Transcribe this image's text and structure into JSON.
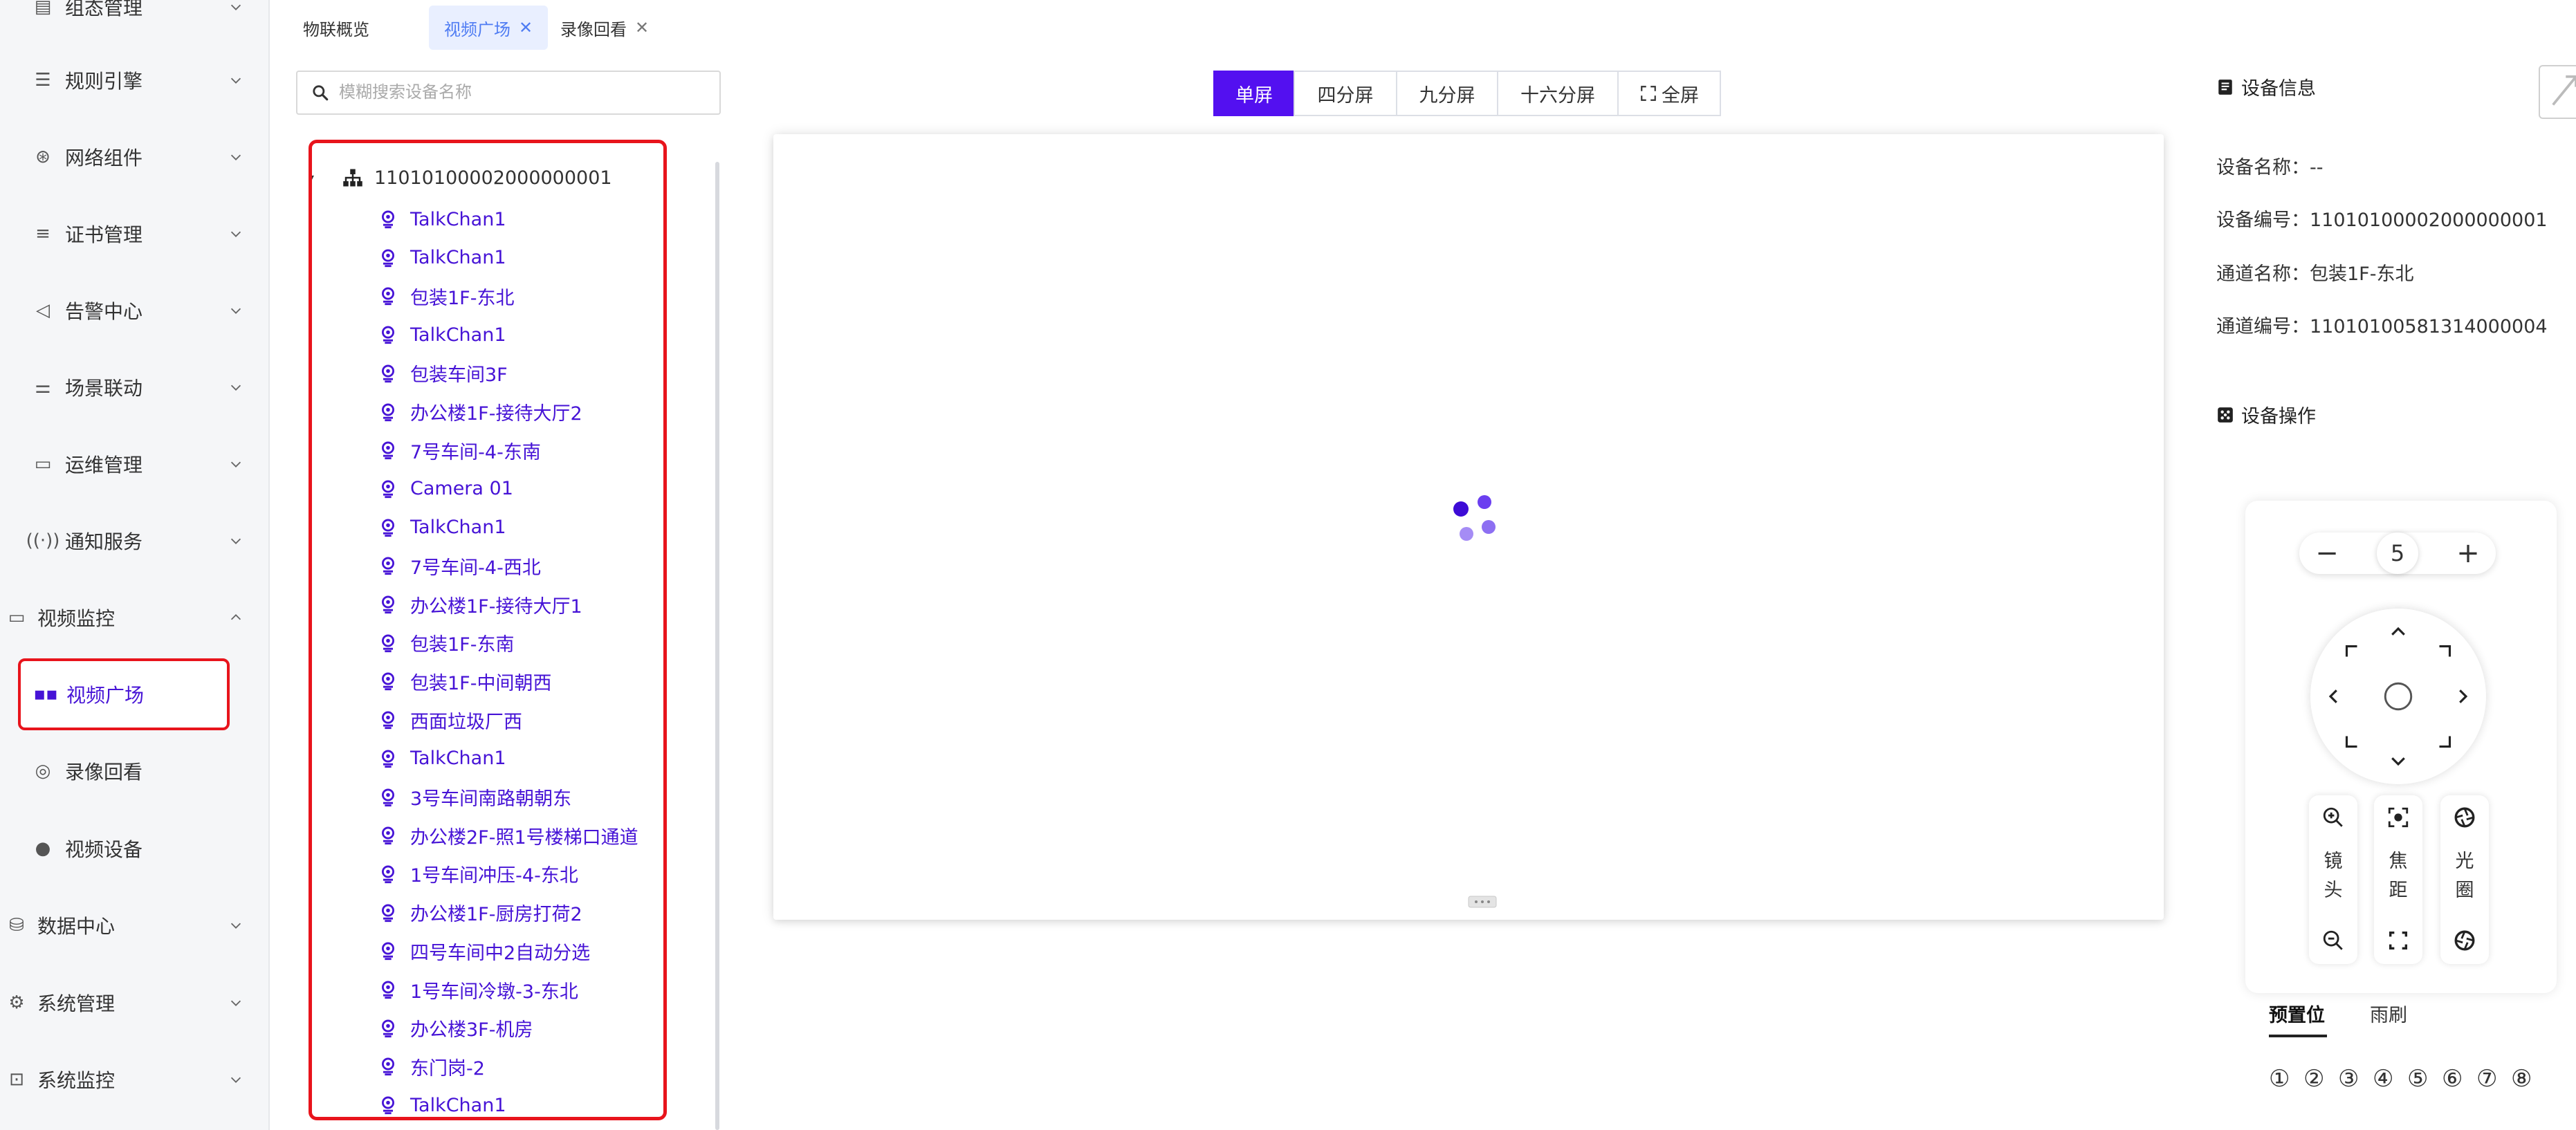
{
  "sidebar": {
    "items": [
      {
        "label": "组态管理",
        "icon": "monitor-icon",
        "expanded": false
      },
      {
        "label": "规则引擎",
        "icon": "list-icon",
        "expanded": false
      },
      {
        "label": "网络组件",
        "icon": "network-icon",
        "expanded": false
      },
      {
        "label": "证书管理",
        "icon": "menu-lines-icon",
        "expanded": false
      },
      {
        "label": "告警中心",
        "icon": "speaker-icon",
        "expanded": false
      },
      {
        "label": "场景联动",
        "icon": "sliders-icon",
        "expanded": false
      },
      {
        "label": "运维管理",
        "icon": "briefcase-icon",
        "expanded": false
      },
      {
        "label": "通知服务",
        "icon": "broadcast-icon",
        "expanded": false
      }
    ],
    "video_group": {
      "label": "视频监控",
      "icon": "video-camera-icon",
      "expanded": true,
      "children": [
        {
          "label": "视频广场",
          "icon": "grid-icon",
          "active": true
        },
        {
          "label": "录像回看",
          "icon": "record-icon",
          "active": false
        },
        {
          "label": "视频设备",
          "icon": "dot-icon",
          "active": false
        }
      ]
    },
    "bottom_items": [
      {
        "label": "数据中心",
        "icon": "database-icon"
      },
      {
        "label": "系统管理",
        "icon": "settings-icon"
      },
      {
        "label": "系统监控",
        "icon": "dashboard-icon"
      }
    ]
  },
  "tabs": [
    {
      "label": "物联概览",
      "closable": false,
      "active": false
    },
    {
      "label": "视频广场",
      "closable": true,
      "active": true
    },
    {
      "label": "录像回看",
      "closable": true,
      "active": false
    }
  ],
  "search": {
    "placeholder": "模糊搜索设备名称",
    "value": ""
  },
  "tree": {
    "root": "11010100002000000001",
    "channels": [
      "TalkChan1",
      "TalkChan1",
      "包装1F-东北",
      "TalkChan1",
      "包装车间3F",
      "办公楼1F-接待大厅2",
      "7号车间-4-东南",
      "Camera 01",
      "TalkChan1",
      "7号车间-4-西北",
      "办公楼1F-接待大厅1",
      "包装1F-东南",
      "包装1F-中间朝西",
      "西面垃圾厂西",
      "TalkChan1",
      "3号车间南路朝朝东",
      "办公楼2F-照1号楼梯口通道",
      "1号车间冲压-4-东北",
      "办公楼1F-厨房打荷2",
      "四号车间中2自动分选",
      "1号车间冷墩-3-东北",
      "办公楼3F-机房",
      "东门岗-2",
      "TalkChan1"
    ]
  },
  "layout_buttons": [
    {
      "label": "单屏",
      "active": true
    },
    {
      "label": "四分屏",
      "active": false
    },
    {
      "label": "九分屏",
      "active": false
    },
    {
      "label": "十六分屏",
      "active": false
    },
    {
      "label": "全屏",
      "active": false,
      "icon": "fullscreen-icon"
    }
  ],
  "device_info": {
    "title": "设备信息",
    "name_label": "设备名称：",
    "name": "--",
    "id_label": "设备编号：",
    "id": "11010100002000000001",
    "channel_name_label": "通道名称：",
    "channel_name": "包装1F-东北",
    "channel_id_label": "通道编号：",
    "channel_id": "11010100581314000004"
  },
  "device_ops": {
    "title": "设备操作",
    "speed": "5",
    "minus": "−",
    "plus": "+",
    "lens_label": [
      "镜",
      "头"
    ],
    "focus_label": [
      "焦",
      "距"
    ],
    "iris_label": [
      "光",
      "圈"
    ],
    "tabs": [
      {
        "label": "预置位",
        "active": true
      },
      {
        "label": "雨刷",
        "active": false
      }
    ],
    "presets": [
      "①",
      "②",
      "③",
      "④",
      "⑤",
      "⑥",
      "⑦",
      "⑧"
    ]
  },
  "colors": {
    "accent": "#5310f0",
    "link": "#4613d6",
    "highlight": "#e8141c",
    "tab_active": "#4f7cf3"
  }
}
